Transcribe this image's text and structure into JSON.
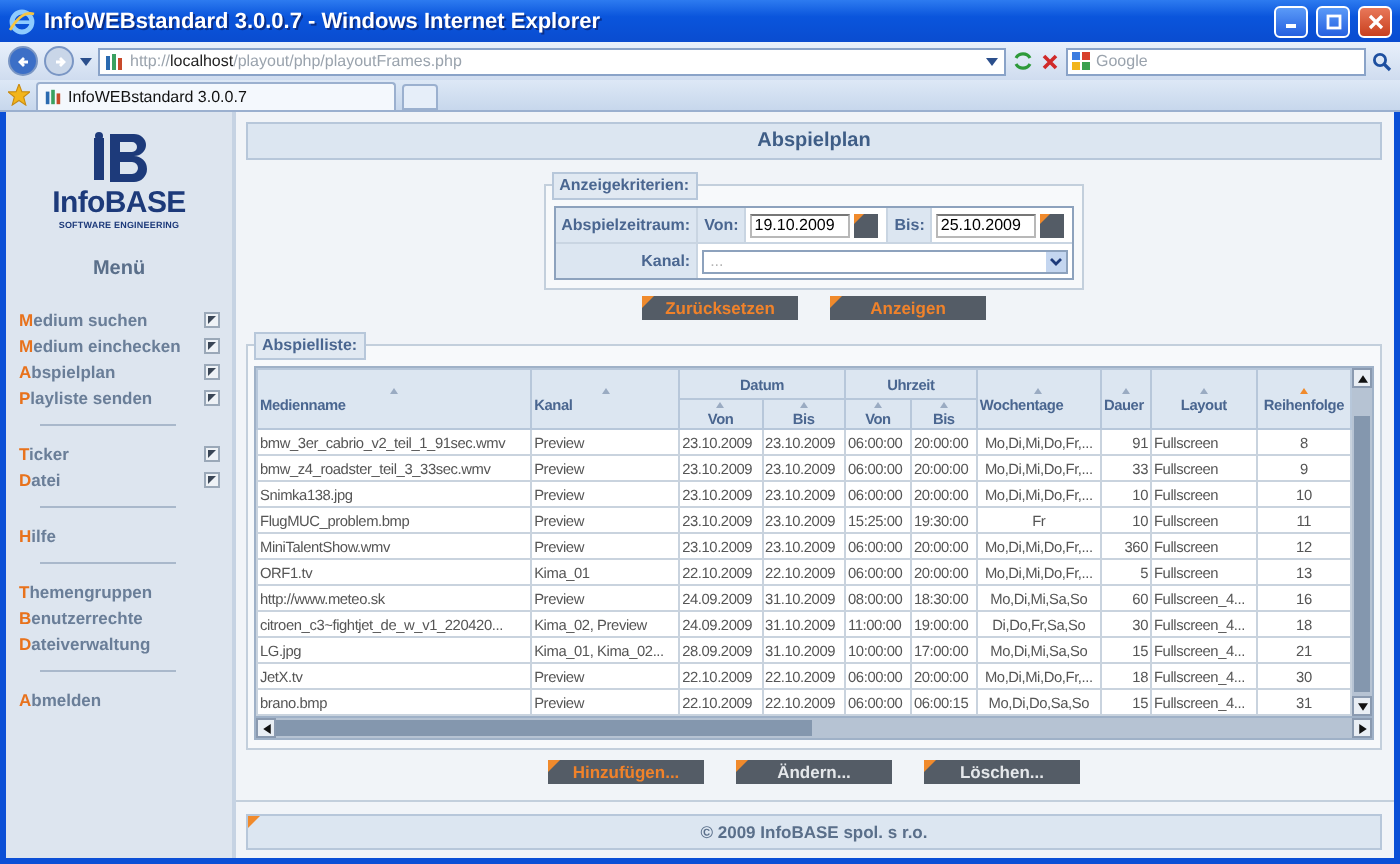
{
  "window": {
    "title": "InfoWEBstandard 3.0.0.7 - Windows Internet Explorer"
  },
  "address_bar": {
    "url": "http://**localhost**/playout/php/playoutFrames.php"
  },
  "search": {
    "placeholder": "Google"
  },
  "tabs": [
    {
      "label": "InfoWEBstandard 3.0.0.7",
      "selected": true
    }
  ],
  "sidebar": {
    "logo": {
      "name": "InfoBASE",
      "tagline": "SOFTWARE ENGINEERING"
    },
    "menu_title": "Menü",
    "groups": [
      [
        {
          "label": "Medium suchen",
          "kind": "icon"
        },
        {
          "label": "Medium einchecken",
          "kind": "icon"
        },
        {
          "label": "Abspielplan",
          "kind": "icon"
        },
        {
          "label": "Playliste senden",
          "kind": "icon"
        }
      ],
      [
        {
          "label": "Ticker",
          "kind": "icon"
        },
        {
          "label": "Datei",
          "kind": "icon"
        }
      ],
      [
        {
          "label": "Hilfe",
          "kind": "plain"
        }
      ],
      [
        {
          "label": "Themengruppen",
          "kind": "plain"
        },
        {
          "label": "Benutzerrechte",
          "kind": "plain"
        },
        {
          "label": "Dateiverwaltung",
          "kind": "plain"
        }
      ],
      [
        {
          "label": "Abmelden",
          "kind": "plain"
        }
      ]
    ]
  },
  "page_title": "Abspielplan",
  "criteria": {
    "legend": "Anzeigekriterien:",
    "period_label": "Abspielzeitraum:",
    "from_label": "Von:",
    "from_value": "19.10.2009",
    "to_label": "Bis:",
    "to_value": "25.10.2009",
    "channel_label": "Kanal:",
    "channel_placeholder": "...",
    "buttons": [
      {
        "label": "Zurücksetzen",
        "disabled": false
      },
      {
        "label": "Anzeigen",
        "disabled": false
      }
    ]
  },
  "list": {
    "legend": "Abspielliste:",
    "columns": [
      {
        "kind": "single",
        "label": "Medienname",
        "sorted": false
      },
      {
        "kind": "single",
        "label": "Kanal",
        "sorted": false
      },
      {
        "kind": "group",
        "label": "Datum",
        "colspan": 2,
        "children": [
          {
            "label": "Von",
            "sorted": false
          },
          {
            "label": "Bis",
            "sorted": false
          }
        ]
      },
      {
        "kind": "group",
        "label": "Uhrzeit",
        "colspan": 2,
        "children": [
          {
            "label": "Von",
            "sorted": false
          },
          {
            "label": "Bis",
            "sorted": false
          }
        ]
      },
      {
        "kind": "single",
        "label": "Wochentage",
        "sorted": false
      },
      {
        "kind": "single",
        "label": "Dauer",
        "sorted": false
      },
      {
        "kind": "single",
        "label": "Layout",
        "sorted": false
      },
      {
        "kind": "single",
        "label": "Reihenfolge",
        "sorted": true
      }
    ],
    "rows": [
      [
        "bmw_3er_cabrio_v2_teil_1_91sec.wmv",
        "Preview",
        "23.10.2009",
        "23.10.2009",
        "06:00:00",
        "20:00:00",
        "Mo,Di,Mi,Do,Fr,...",
        "91",
        "Fullscreen",
        "8"
      ],
      [
        "bmw_z4_roadster_teil_3_33sec.wmv",
        "Preview",
        "23.10.2009",
        "23.10.2009",
        "06:00:00",
        "20:00:00",
        "Mo,Di,Mi,Do,Fr,...",
        "33",
        "Fullscreen",
        "9"
      ],
      [
        "Snimka138.jpg",
        "Preview",
        "23.10.2009",
        "23.10.2009",
        "06:00:00",
        "20:00:00",
        "Mo,Di,Mi,Do,Fr,...",
        "10",
        "Fullscreen",
        "10"
      ],
      [
        "FlugMUC_problem.bmp",
        "Preview",
        "23.10.2009",
        "23.10.2009",
        "15:25:00",
        "19:30:00",
        "Fr",
        "10",
        "Fullscreen",
        "11"
      ],
      [
        "MiniTalentShow.wmv",
        "Preview",
        "23.10.2009",
        "23.10.2009",
        "06:00:00",
        "20:00:00",
        "Mo,Di,Mi,Do,Fr,...",
        "360",
        "Fullscreen",
        "12"
      ],
      [
        "ORF1.tv",
        "Kima_01",
        "22.10.2009",
        "22.10.2009",
        "06:00:00",
        "20:00:00",
        "Mo,Di,Mi,Do,Fr,...",
        "5",
        "Fullscreen",
        "13"
      ],
      [
        "http://www.meteo.sk",
        "Preview",
        "24.09.2009",
        "31.10.2009",
        "08:00:00",
        "18:30:00",
        "Mo,Di,Mi,Sa,So",
        "60",
        "Fullscreen_4...",
        "16"
      ],
      [
        "citroen_c3~fightjet_de_w_v1_220420...",
        "Kima_02, Preview",
        "24.09.2009",
        "31.10.2009",
        "11:00:00",
        "19:00:00",
        "Di,Do,Fr,Sa,So",
        "30",
        "Fullscreen_4...",
        "18"
      ],
      [
        "LG.jpg",
        "Kima_01, Kima_02...",
        "28.09.2009",
        "31.10.2009",
        "10:00:00",
        "17:00:00",
        "Mo,Di,Mi,Sa,So",
        "15",
        "Fullscreen_4...",
        "21"
      ],
      [
        "JetX.tv",
        "Preview",
        "22.10.2009",
        "22.10.2009",
        "06:00:00",
        "20:00:00",
        "Mo,Di,Mi,Do,Fr,...",
        "18",
        "Fullscreen_4...",
        "30"
      ],
      [
        "brano.bmp",
        "Preview",
        "22.10.2009",
        "22.10.2009",
        "06:00:00",
        "06:00:15",
        "Mo,Di,Do,Sa,So",
        "15",
        "Fullscreen_4...",
        "31"
      ]
    ],
    "buttons": [
      {
        "label": "Hinzufügen...",
        "disabled": false
      },
      {
        "label": "Ändern...",
        "disabled": true
      },
      {
        "label": "Löschen...",
        "disabled": true
      }
    ]
  },
  "footer": "© 2009 InfoBASE spol. s r.o."
}
